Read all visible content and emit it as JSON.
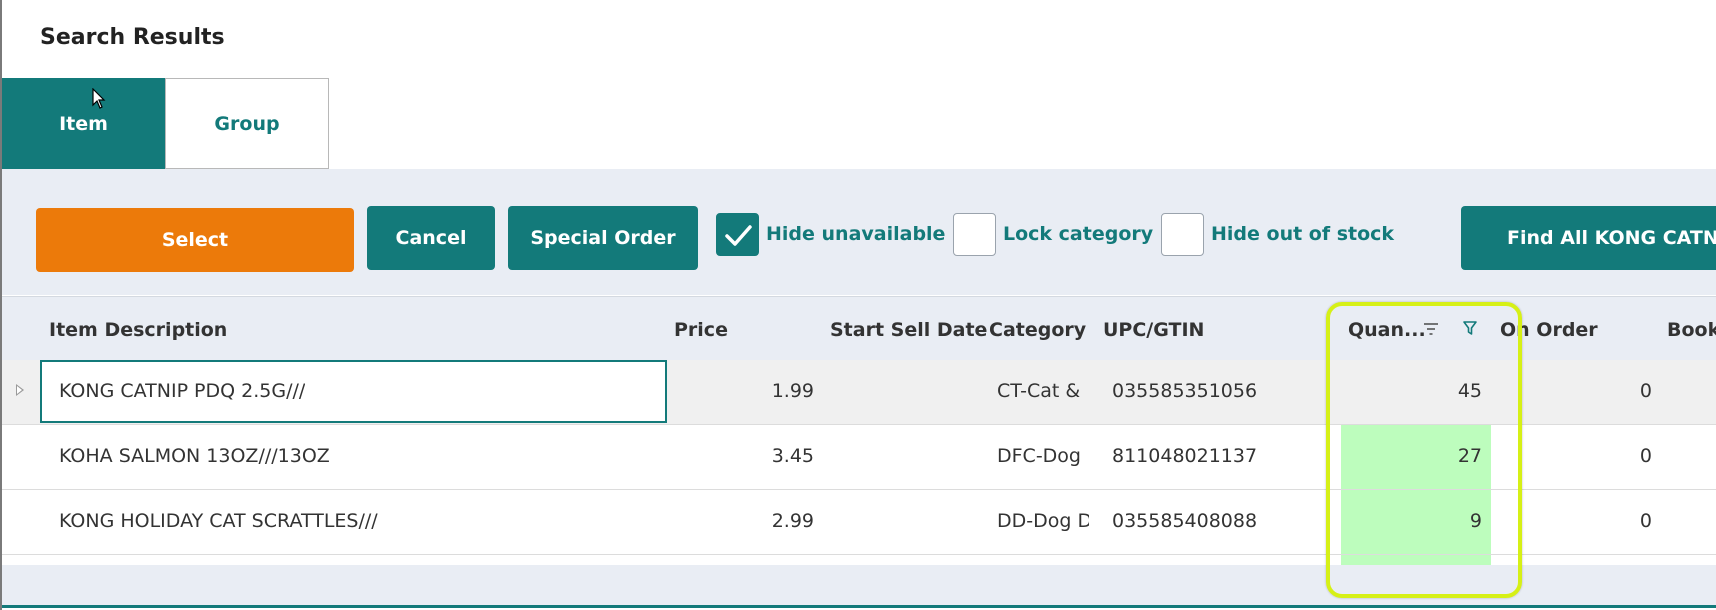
{
  "page": {
    "title": "Search Results"
  },
  "tabs": [
    {
      "label": "Item",
      "active": true
    },
    {
      "label": "Group",
      "active": false
    }
  ],
  "toolbar": {
    "select_label": "Select",
    "cancel_label": "Cancel",
    "special_order_label": "Special Order",
    "hide_unavailable": {
      "label": "Hide unavailable",
      "checked": true
    },
    "lock_category": {
      "label": "Lock category",
      "checked": false
    },
    "hide_out_of_stock": {
      "label": "Hide out of stock",
      "checked": false
    },
    "find_all_label": "Find All KONG CATNI..."
  },
  "grid": {
    "columns": [
      "Item Description",
      "Price",
      "Start Sell Date",
      "Category",
      "UPC/GTIN",
      "Quan...",
      "On Order",
      "Booki"
    ],
    "rows": [
      {
        "description": "KONG CATNIP PDQ 2.5G///",
        "price": "1.99",
        "start_sell_date": "",
        "category": "CT-Cat &",
        "upc": "035585351056",
        "quantity": "45",
        "on_order": "0"
      },
      {
        "description": "KOHA SALMON 13OZ///13OZ",
        "price": "3.45",
        "start_sell_date": "",
        "category": "DFC-Dog",
        "upc": "811048021137",
        "quantity": "27",
        "on_order": "0"
      },
      {
        "description": "KONG HOLIDAY CAT SCRATTLES///",
        "price": "2.99",
        "start_sell_date": "",
        "category": "DD-Dog D",
        "upc": "035585408088",
        "quantity": "9",
        "on_order": "0"
      }
    ]
  },
  "colors": {
    "accent": "#137a7a",
    "select_button": "#ec7a0a",
    "toolbar_bg": "#e9edf4",
    "quantity_highlight": "#bdfdbd",
    "annotation_outline": "#d6f016"
  },
  "icons": {
    "sort": "sort-icon",
    "filter": "filter-icon",
    "checkmark": "checkmark-icon",
    "expander": "row-expand-icon",
    "cursor": "mouse-cursor-icon"
  }
}
